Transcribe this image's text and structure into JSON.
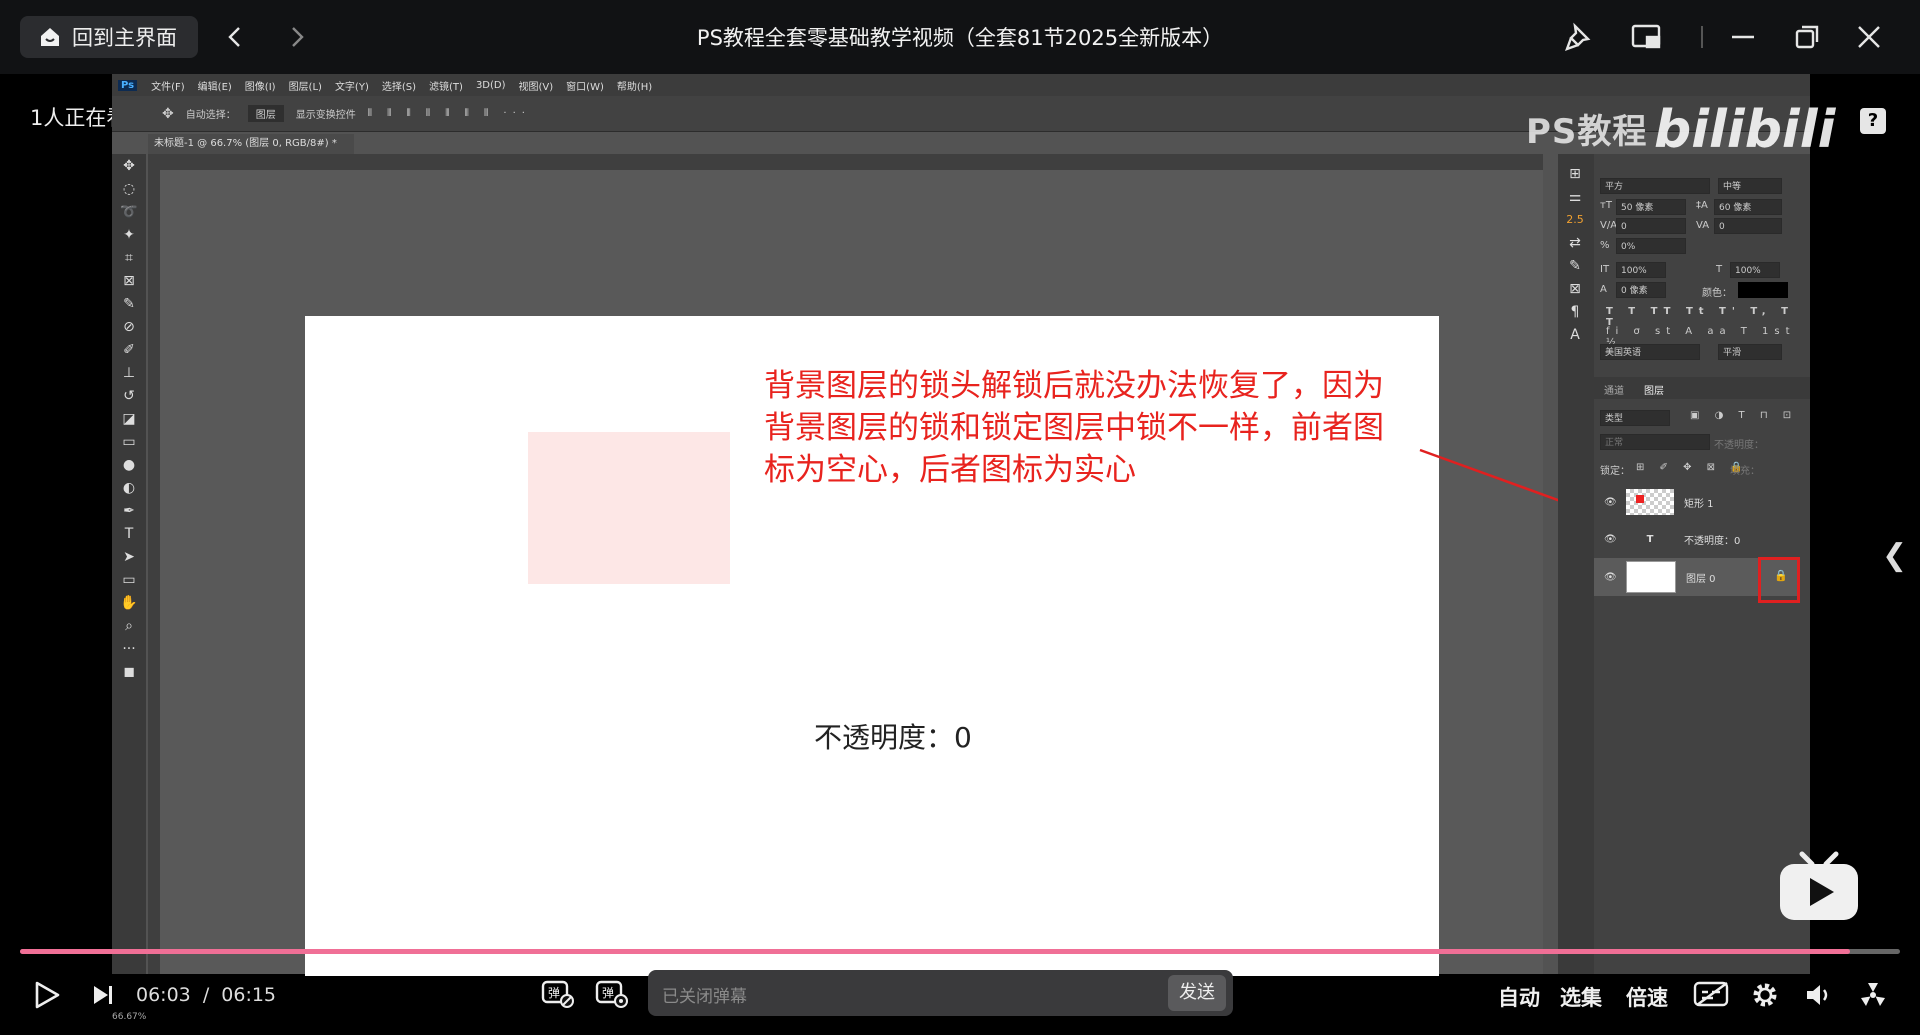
{
  "titlebar": {
    "home_label": "回到主界面",
    "title": "PS教程全套零基础教学视频（全套81节2025全新版本）"
  },
  "video": {
    "viewers_text": "1人正在看",
    "watermark_text": "PS教程",
    "watermark_logo": "bilibili",
    "help_icon": "question-icon"
  },
  "photoshop": {
    "menu": [
      "文件(F)",
      "编辑(E)",
      "图像(I)",
      "图层(L)",
      "文字(Y)",
      "选择(S)",
      "滤镜(T)",
      "3D(D)",
      "视图(V)",
      "窗口(W)",
      "帮助(H)"
    ],
    "options": {
      "auto_select": "自动选择：",
      "auto_select_value": "图层",
      "show_transform": "显示变换控件"
    },
    "doc_tab": "未标题-1 @ 66.7% (图层 0, RGB/8#) *",
    "canvas_text": "不透明度：0",
    "annotation": "背景图层的锁头解锁后就没办法恢复了，因为背景图层的锁和锁定图层中锁不一样，前者图标为空心，后者图标为实心",
    "character": {
      "font_style": "平方",
      "weight": "中等",
      "size": "50 像素",
      "leading": "60 像素",
      "kerning": "0",
      "tracking": "0",
      "scale_pct": "0%",
      "vscale": "100%",
      "hscale": "100%",
      "baseline": "0 像素",
      "color_label": "颜色：",
      "language": "美国英语",
      "aa": "平滑"
    },
    "layers_panel": {
      "tab_channels": "通道",
      "tab_layers": "图层",
      "filter": "类型",
      "blend": "正常",
      "opacity_label": "不透明度：",
      "lock_label": "锁定：",
      "fill_label": "填充：",
      "layers": [
        {
          "name": "矩形 1"
        },
        {
          "name": "不透明度：0"
        },
        {
          "name": "图层 0"
        }
      ]
    },
    "status": "66.67%"
  },
  "player": {
    "current_time": "06:03",
    "separator": "/",
    "duration": "06:15",
    "progress": 0.9733,
    "danmaku_placeholder": "已关闭弹幕",
    "send_label": "发送",
    "quality_label": "自动",
    "episodes_label": "选集",
    "speed_label": "倍速"
  }
}
